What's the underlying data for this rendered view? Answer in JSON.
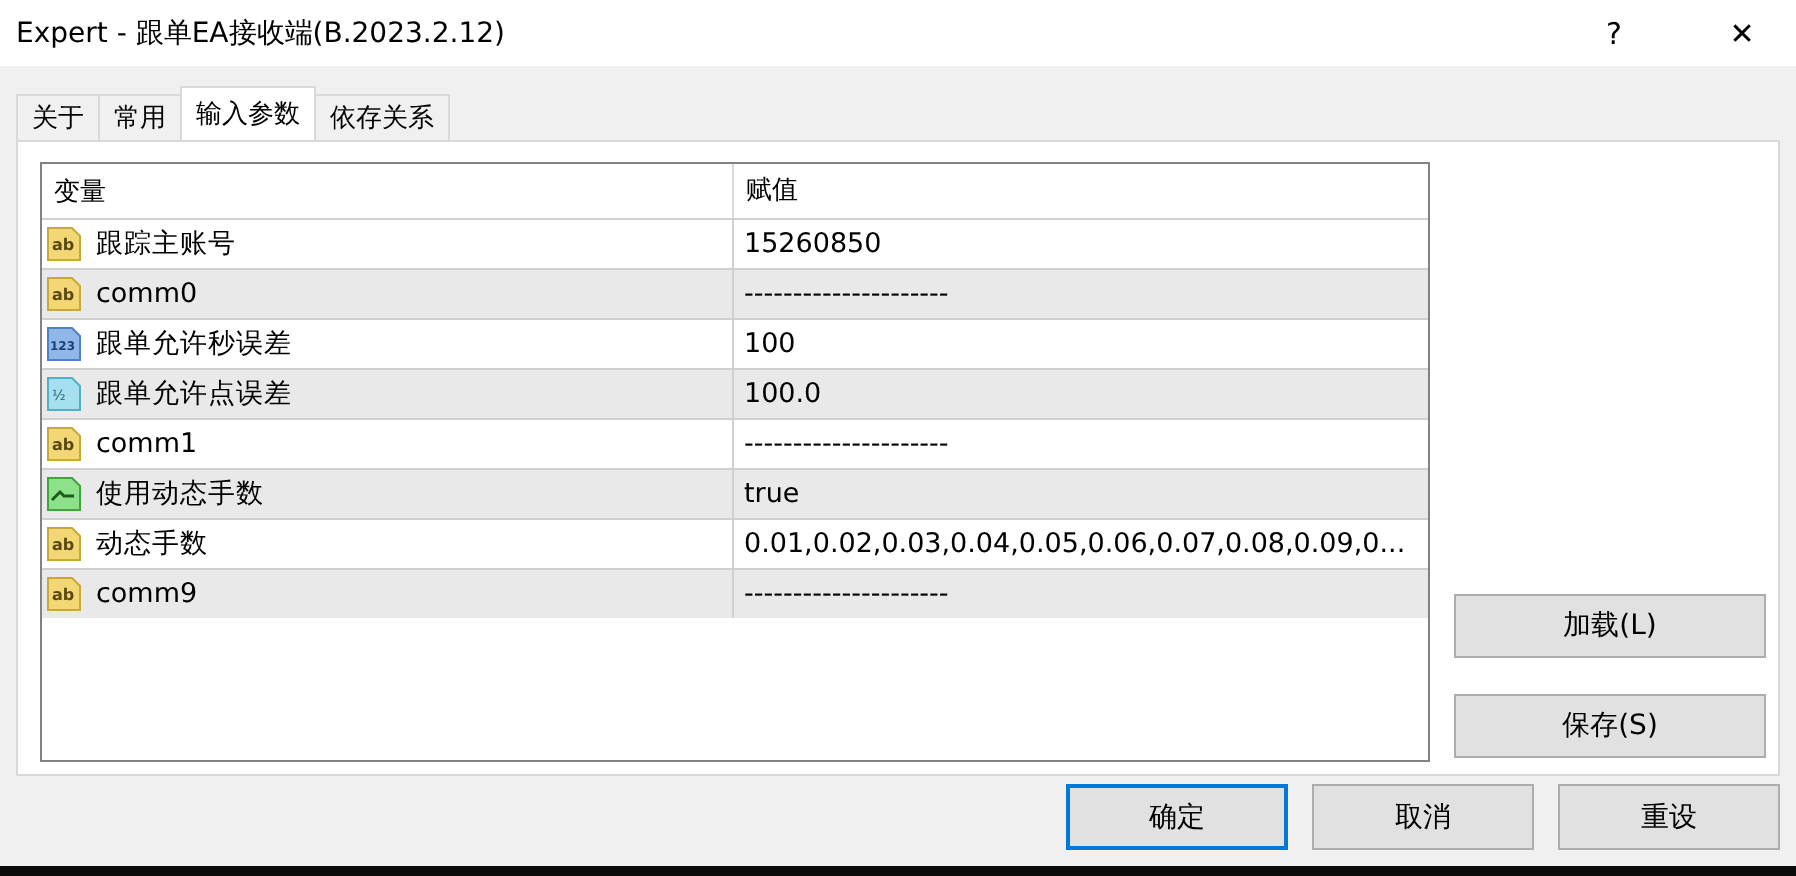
{
  "window": {
    "title": "Expert - 跟单EA接收端(B.2023.2.12)",
    "help": "?",
    "close": "✕"
  },
  "tabs": [
    {
      "label": "关于",
      "selected": false
    },
    {
      "label": "常用",
      "selected": false
    },
    {
      "label": "输入参数",
      "selected": true
    },
    {
      "label": "依存关系",
      "selected": false
    }
  ],
  "table": {
    "columns": [
      "变量",
      "赋值"
    ],
    "rows": [
      {
        "kind": "string",
        "icon_label": "ab",
        "name": "跟踪主账号",
        "value": "15260850"
      },
      {
        "kind": "string",
        "icon_label": "ab",
        "name": "comm0",
        "value": "---------------------"
      },
      {
        "kind": "int",
        "icon_label": "123",
        "name": "跟单允许秒误差",
        "value": "100"
      },
      {
        "kind": "double",
        "icon_label": "½",
        "name": "跟单允许点误差",
        "value": "100.0"
      },
      {
        "kind": "string",
        "icon_label": "ab",
        "name": "comm1",
        "value": "---------------------"
      },
      {
        "kind": "bool",
        "name": "使用动态手数",
        "value": "true"
      },
      {
        "kind": "string",
        "icon_label": "ab",
        "name": "动态手数",
        "value": "0.01,0.02,0.03,0.04,0.05,0.06,0.07,0.08,0.09,0..."
      },
      {
        "kind": "string",
        "icon_label": "ab",
        "name": "comm9",
        "value": "---------------------"
      }
    ]
  },
  "side_buttons": [
    "加载(L)",
    "保存(S)"
  ],
  "buttons": [
    {
      "label": "确定",
      "default": true
    },
    {
      "label": "取消",
      "default": false
    },
    {
      "label": "重设",
      "default": false
    }
  ]
}
